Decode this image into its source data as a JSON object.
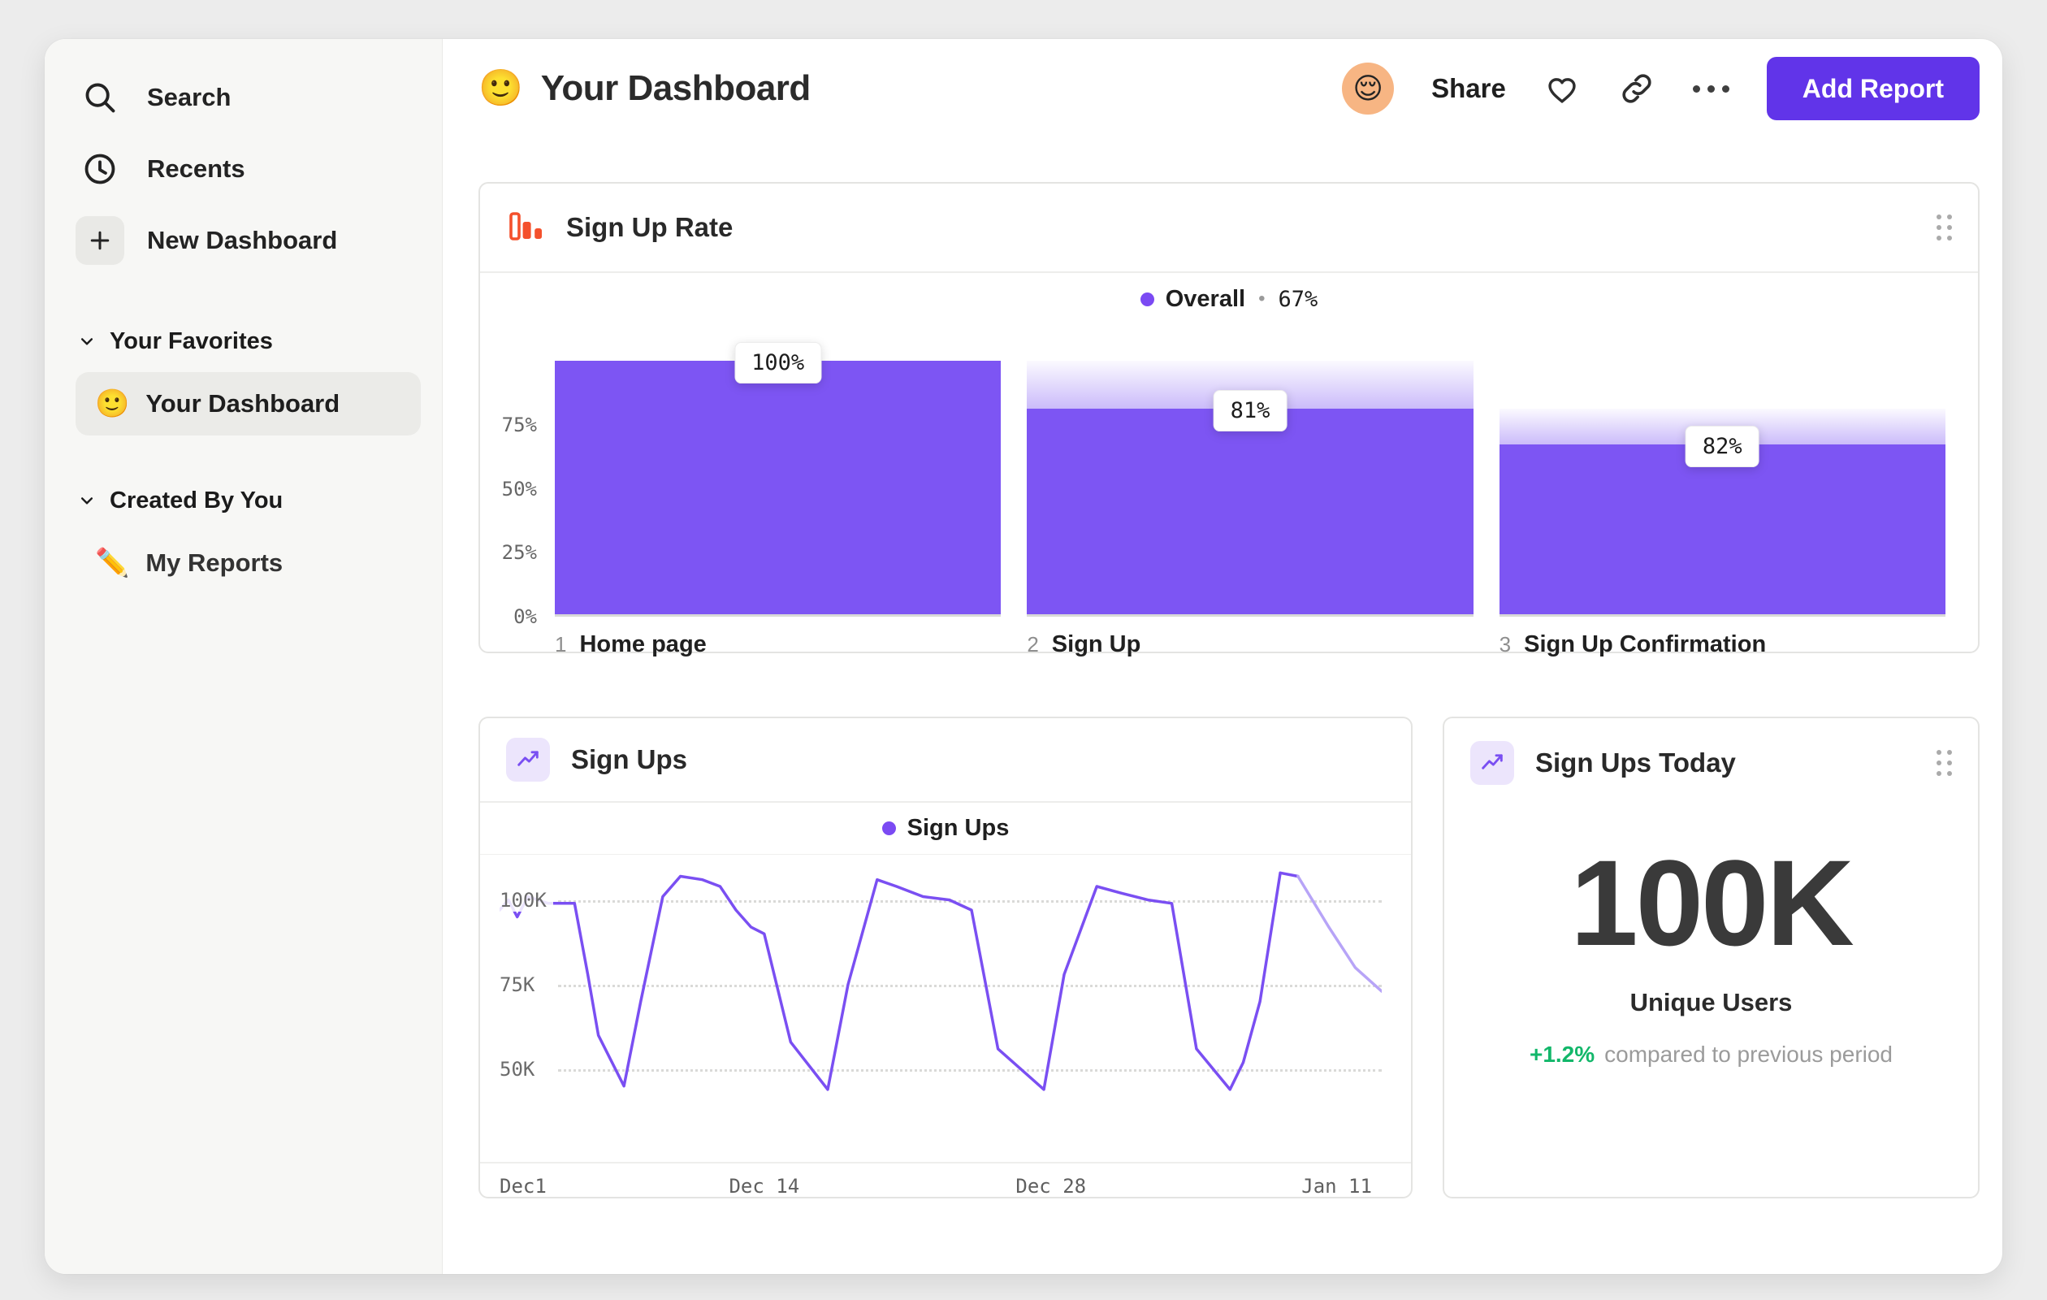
{
  "colors": {
    "accent_purple": "#7a4ff2",
    "bar_purple": "#7d55f3",
    "button_purple": "#6134e9",
    "funnel_icon_orange": "#f4502c",
    "delta_green": "#12b76a",
    "avatar_bg": "#f7b583"
  },
  "sidebar": {
    "nav": [
      {
        "label": "Search"
      },
      {
        "label": "Recents"
      },
      {
        "label": "New Dashboard"
      }
    ],
    "sections": [
      {
        "label": "Your Favorites",
        "item_emoji": "🙂",
        "item_label": "Your Dashboard"
      },
      {
        "label": "Created By You",
        "item_emoji": "✏️",
        "item_label": "My Reports"
      }
    ]
  },
  "header": {
    "emoji": "🙂",
    "title": "Your Dashboard",
    "avatar_emoji": "😌",
    "share_label": "Share",
    "add_report_label": "Add Report"
  },
  "funnel_card": {
    "title": "Sign Up Rate",
    "legend_name": "Overall",
    "legend_sep": "•",
    "legend_value": "67%"
  },
  "line_card": {
    "title": "Sign Ups",
    "legend_name": "Sign Ups"
  },
  "metric_card": {
    "title": "Sign Ups Today",
    "value": "100K",
    "label": "Unique Users",
    "delta": "+1.2%",
    "delta_desc": "compared to previous period"
  },
  "chart_data": [
    {
      "type": "bar",
      "title": "Sign Up Rate",
      "legend": "Overall • 67%",
      "categories": [
        "Home page",
        "Sign Up",
        "Sign Up Confirmation"
      ],
      "category_numbers": [
        "1",
        "2",
        "3"
      ],
      "values": [
        100,
        81,
        67
      ],
      "prev_values": [
        100,
        100,
        81
      ],
      "bar_labels": [
        "100%",
        "81%",
        "82%"
      ],
      "ylim": [
        0,
        100
      ],
      "yticks": [
        {
          "v": 0,
          "label": "0%"
        },
        {
          "v": 25,
          "label": "25%"
        },
        {
          "v": 50,
          "label": "50%"
        },
        {
          "v": 75,
          "label": "75%"
        }
      ],
      "bar_color": "#7d55f3"
    },
    {
      "type": "line",
      "title": "Sign Ups",
      "legend": "Sign Ups",
      "unit": "K",
      "ylim": [
        25,
        110
      ],
      "yticks": [
        {
          "v": 50,
          "label": "50K"
        },
        {
          "v": 75,
          "label": "75K"
        },
        {
          "v": 100,
          "label": "100K"
        }
      ],
      "xticks": [
        {
          "x": 0.0,
          "label": "Dec1"
        },
        {
          "x": 0.3,
          "label": "Dec 14"
        },
        {
          "x": 0.625,
          "label": "Dec 28"
        },
        {
          "x": 0.949,
          "label": "Jan 11"
        }
      ],
      "series": [
        {
          "name": "Sign Ups",
          "color": "#7a4ff2",
          "forecast_from": 0.905,
          "points": [
            [
              0.0,
              97
            ],
            [
              0.01,
              100
            ],
            [
              0.02,
              95
            ],
            [
              0.032,
              101
            ],
            [
              0.055,
              99
            ],
            [
              0.085,
              99
            ],
            [
              0.1,
              78
            ],
            [
              0.112,
              60
            ],
            [
              0.141,
              45
            ],
            [
              0.16,
              70
            ],
            [
              0.185,
              101
            ],
            [
              0.205,
              107
            ],
            [
              0.23,
              106
            ],
            [
              0.25,
              104
            ],
            [
              0.268,
              97
            ],
            [
              0.285,
              92
            ],
            [
              0.3,
              90
            ],
            [
              0.33,
              58
            ],
            [
              0.372,
              44
            ],
            [
              0.395,
              75
            ],
            [
              0.428,
              106
            ],
            [
              0.45,
              104
            ],
            [
              0.48,
              101
            ],
            [
              0.51,
              100
            ],
            [
              0.535,
              97
            ],
            [
              0.565,
              56
            ],
            [
              0.617,
              44
            ],
            [
              0.64,
              78
            ],
            [
              0.677,
              104
            ],
            [
              0.705,
              102
            ],
            [
              0.735,
              100
            ],
            [
              0.762,
              99
            ],
            [
              0.79,
              56
            ],
            [
              0.828,
              44
            ],
            [
              0.843,
              52
            ],
            [
              0.862,
              70
            ],
            [
              0.885,
              108
            ],
            [
              0.905,
              107
            ],
            [
              0.94,
              92
            ],
            [
              0.97,
              80
            ],
            [
              1.0,
              73
            ]
          ]
        }
      ]
    }
  ]
}
